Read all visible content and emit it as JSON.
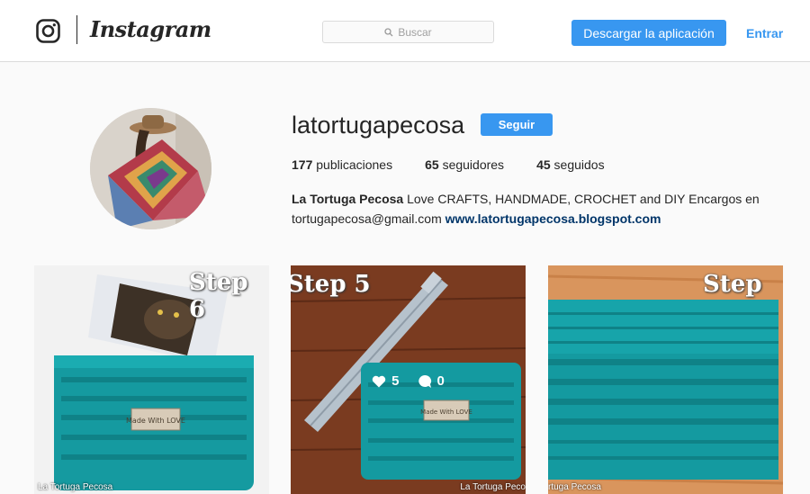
{
  "header": {
    "wordmark": "Instagram",
    "search_placeholder": "Buscar",
    "download_label": "Descargar la aplicación",
    "login_label": "Entrar"
  },
  "profile": {
    "username": "latortugapecosa",
    "follow_label": "Seguir",
    "stats": {
      "posts_count": "177",
      "posts_label": "publicaciones",
      "followers_count": "65",
      "followers_label": "seguidores",
      "following_count": "45",
      "following_label": "seguidos"
    },
    "bio": {
      "name": "La Tortuga Pecosa",
      "text": " Love CRAFTS, HANDMADE, CROCHET and DIY Encargos en tortugapecosa@gmail.com ",
      "link": "www.latortugapecosa.blogspot.com"
    }
  },
  "posts": [
    {
      "step_label": "Step 6",
      "patch_text": "Made With LOVE",
      "watermark": "La Tortuga Pecosa"
    },
    {
      "step_label": "Step 5",
      "patch_text": "Made With LOVE",
      "watermark": "La Tortuga Peco",
      "likes": "5",
      "comments": "0"
    },
    {
      "step_label": "Step",
      "watermark": "rtuga Pecosa"
    }
  ],
  "colors": {
    "accent": "#3897f0",
    "link": "#003569",
    "teal_yarn": "#159aa0"
  }
}
